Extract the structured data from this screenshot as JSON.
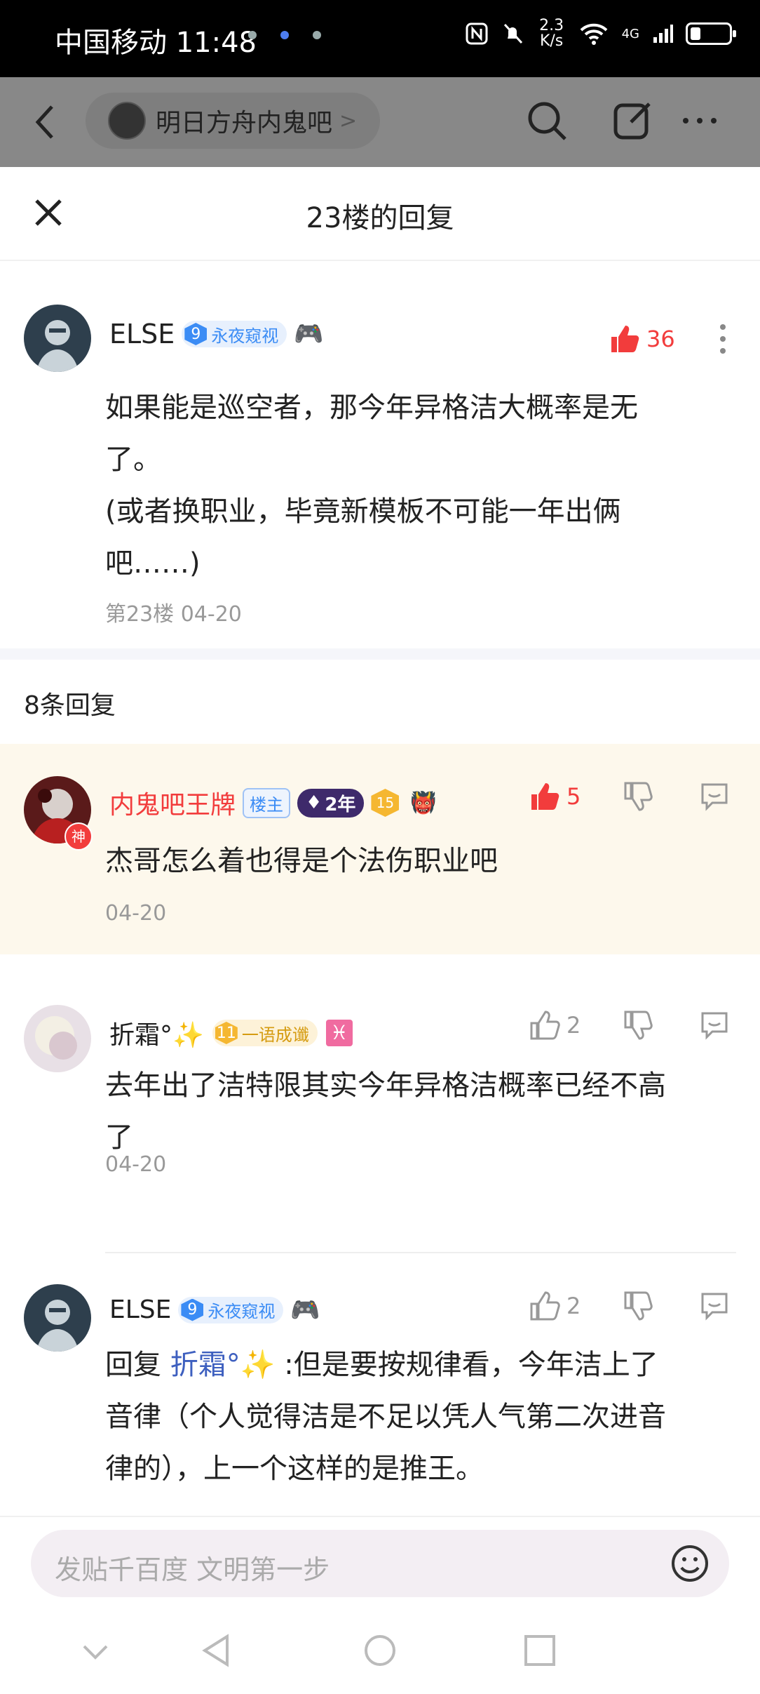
{
  "status": {
    "time": "中国移动 11:48",
    "net": "2.3 K/s",
    "sig": "4G"
  },
  "forum": {
    "name": "明日方舟内鬼吧"
  },
  "sheet": {
    "title": "23楼的回复"
  },
  "op": {
    "name": "ELSE",
    "level": "9",
    "title": "永夜窥视",
    "likes": "36",
    "text": "如果能是巡空者，那今年异格洁大概率是无了。\n(或者换职业，毕竟新模板不可能一年出俩吧……)",
    "line1": "如果能是巡空者，那今年异格洁大概率是无",
    "line2": "了。",
    "line3": "(或者换职业，毕竟新模板不可能一年出俩",
    "line4": "吧……)",
    "meta": "第23楼  04-20"
  },
  "replies_count": "8条回复",
  "replies": [
    {
      "name": "内鬼吧王牌",
      "tag": "楼主",
      "years": "2年",
      "level": "15",
      "likes": "5",
      "text": "杰哥怎么着也得是个法伤职业吧",
      "meta": "04-20",
      "avatar_tag": "神"
    },
    {
      "name": "折霜°✨",
      "level": "11",
      "title": "一语成谶",
      "likes": "2",
      "line1": "去年出了洁特限其实今年异格洁概率已经不高",
      "line2": "了",
      "meta": "04-20"
    },
    {
      "name": "ELSE",
      "level": "9",
      "title": "永夜窥视",
      "likes": "2",
      "prefix": "回复 ",
      "mention": "折霜°✨",
      "line1": " :但是要按规律看，今年洁上了",
      "line2": "音律（个人觉得洁是不足以凭人气第二次进音",
      "line3": "律的），上一个这样的是推王。"
    }
  ],
  "input": {
    "placeholder": "发贴千百度 文明第一步"
  },
  "colors": {
    "like_red": "#f23c3c",
    "level_blue": "#3b8cf5",
    "gold": "#f5b731",
    "mention_blue": "#3d5fbf",
    "host_bg": "#fdf8ec"
  }
}
